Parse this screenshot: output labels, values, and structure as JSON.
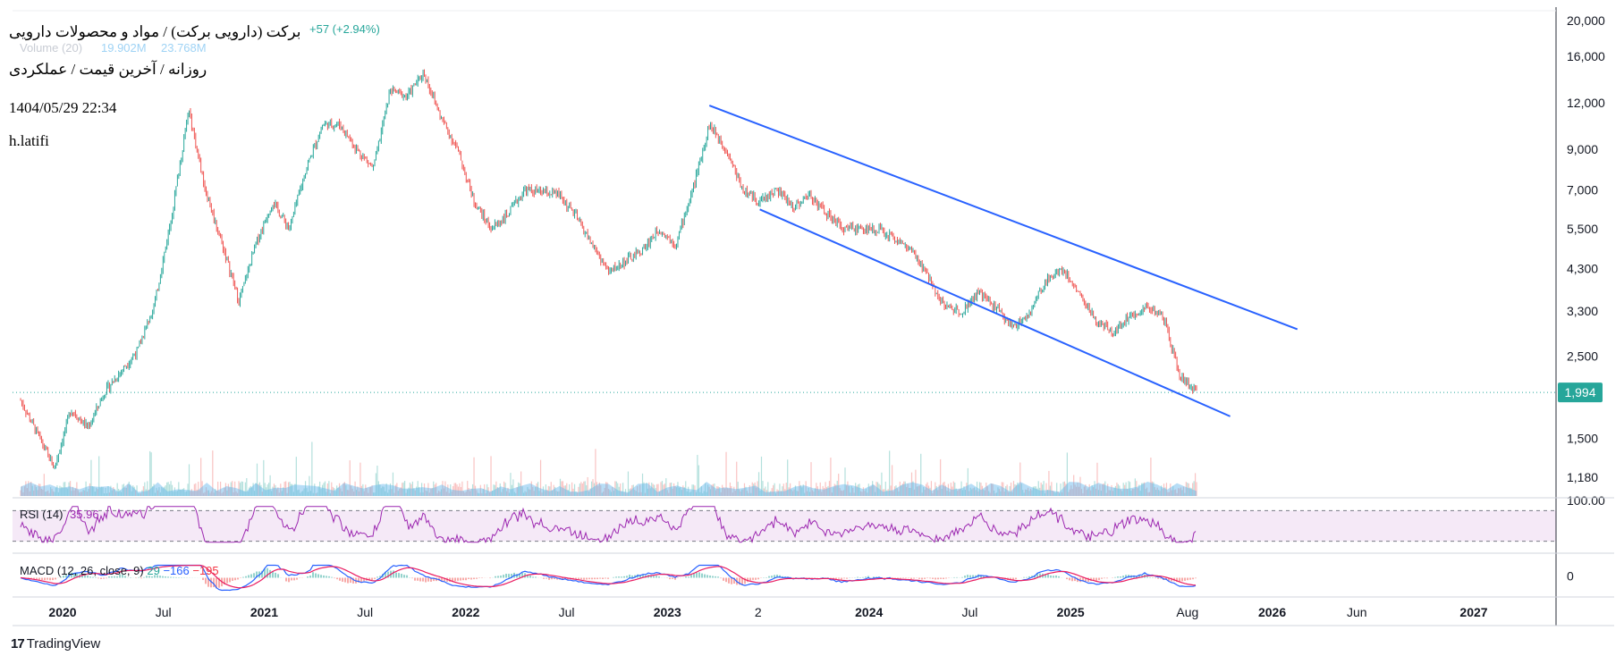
{
  "header": {
    "title": "برکت (دارویی برکت) / مواد و محصولات دارویی",
    "subtitle": "روزانه / آخرین قیمت / عملکردی",
    "datetime": "1404/05/29 22:34",
    "author": "h.latifi",
    "change": "+57 (+2.94%)",
    "volume_label": "Volume (20)",
    "volume_value_1": "19.902M",
    "volume_value_2": "23.768M"
  },
  "colors": {
    "up": "#26a69a",
    "down": "#ef5350",
    "channel": "#2962ff",
    "rsi": "#9c27b0",
    "macd": "#2962ff",
    "signal": "#e91e63",
    "volume": "#5fb4ea",
    "price_badge": "#26a69a"
  },
  "chart_data": [
    {
      "type": "line",
      "title": "",
      "scale": "log",
      "ylim": [
        1000,
        20000
      ],
      "y_ticks": [
        "20,000",
        "16,000",
        "12,000",
        "9,000",
        "7,000",
        "5,500",
        "4,300",
        "3,300",
        "2,500",
        "1,994",
        "1,500",
        "1,180"
      ],
      "x_ticks": [
        "2020",
        "Jul",
        "2021",
        "Jul",
        "2022",
        "Jul",
        "2023",
        "2",
        "2024",
        "Jul",
        "2025",
        "Aug",
        "2026",
        "Jun",
        "2027"
      ],
      "last_price": 1994,
      "series": [
        {
          "x": [
            "2019-10",
            "2019-12",
            "2020-01",
            "2020-02",
            "2020-03",
            "2020-05",
            "2020-06",
            "2020-07",
            "2020-08",
            "2020-09",
            "2020-10",
            "2020-11",
            "2020-12",
            "2021-01",
            "2021-02",
            "2021-03",
            "2021-04",
            "2021-05",
            "2021-06",
            "2021-07",
            "2021-08",
            "2021-09",
            "2021-10",
            "2021-11",
            "2021-12",
            "2022-01",
            "2022-02",
            "2022-03",
            "2022-04",
            "2022-06",
            "2022-07",
            "2022-08",
            "2022-09",
            "2022-10",
            "2022-11",
            "2022-12",
            "2023-01",
            "2023-02",
            "2023-03",
            "2023-04",
            "2023-05",
            "2023-06",
            "2023-07",
            "2023-08",
            "2023-09",
            "2023-10",
            "2023-11",
            "2024-01",
            "2024-02",
            "2024-03",
            "2024-04",
            "2024-05",
            "2024-06",
            "2024-07",
            "2024-08",
            "2024-09",
            "2024-10",
            "2024-11",
            "2024-12",
            "2025-01",
            "2025-02",
            "2025-03",
            "2025-04",
            "2025-05",
            "2025-06",
            "2025-07",
            "2025-08"
          ],
          "values": [
            1900,
            1250,
            1800,
            1600,
            2000,
            2600,
            3500,
            6000,
            11500,
            7000,
            5000,
            3500,
            5000,
            6500,
            5500,
            8000,
            10500,
            10500,
            9000,
            8000,
            13000,
            12500,
            14500,
            11000,
            9000,
            6500,
            5500,
            6000,
            7000,
            6800,
            6000,
            5000,
            4200,
            4500,
            4800,
            5500,
            5000,
            7000,
            10500,
            9000,
            7000,
            6500,
            7000,
            6300,
            6800,
            6000,
            5500,
            5500,
            5200,
            4800,
            4100,
            3400,
            3300,
            3700,
            3400,
            3000,
            3200,
            4000,
            4300,
            3700,
            3100,
            2900,
            3200,
            3400,
            3200,
            2200,
            1994
          ]
        }
      ],
      "channel": {
        "upper": {
          "from": [
            "2023-03",
            11800
          ],
          "to": [
            "2026-02",
            2950
          ]
        },
        "lower": {
          "from": [
            "2023-06",
            6200
          ],
          "to": [
            "2025-10",
            1720
          ]
        }
      }
    },
    {
      "type": "bar",
      "title": "Volume (20)",
      "values": [
        "19.902M",
        "23.768M"
      ]
    },
    {
      "type": "line",
      "title": "RSI (14)",
      "value": "35.96",
      "ylim": [
        0,
        100
      ],
      "y_ticks": [
        "100.00"
      ],
      "bands": [
        30,
        70
      ]
    },
    {
      "type": "line",
      "title": "MACD (12, 26, close, 9)",
      "values": [
        "29",
        "−166",
        "−195"
      ],
      "y_ticks": [
        "0"
      ]
    }
  ]
}
